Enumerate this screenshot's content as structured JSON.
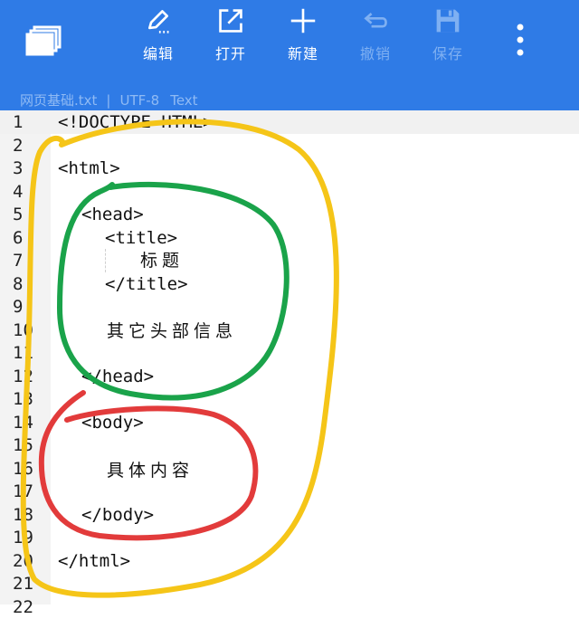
{
  "toolbar": {
    "icons": {
      "tabs": "tabs-stack-icon",
      "edit": "pen-edit-icon",
      "open": "open-external-icon",
      "new": "plus-icon",
      "undo": "undo-arrow-icon",
      "save": "floppy-disk-icon",
      "more": "more-vertical-icon"
    },
    "edit_label": "编辑",
    "open_label": "打开",
    "new_label": "新建",
    "undo_label": "撤销",
    "save_label": "保存"
  },
  "file": {
    "name": "网页基础.txt",
    "separator": "|",
    "encoding": "UTF-8",
    "type": "Text"
  },
  "editor": {
    "line_numbers": [
      "1",
      "2",
      "3",
      "4",
      "5",
      "6",
      "7",
      "8",
      "9",
      "10",
      "11",
      "12",
      "13",
      "14",
      "15",
      "16",
      "17",
      "18",
      "19",
      "20",
      "21",
      "22"
    ],
    "lines": {
      "l1": "<!DOCTYPE HTML>",
      "l3": "<html>",
      "l5": "<head>",
      "l6": "<title>",
      "l7": "标题",
      "l8": "</title>",
      "l10": "其它头部信息",
      "l12": "</head>",
      "l14": "<body>",
      "l16": "具体内容",
      "l18": "</body>",
      "l20": "</html>"
    }
  },
  "annotation_colors": {
    "yellow": "#f5c518",
    "green": "#1aa34a",
    "red": "#e23b3b"
  }
}
